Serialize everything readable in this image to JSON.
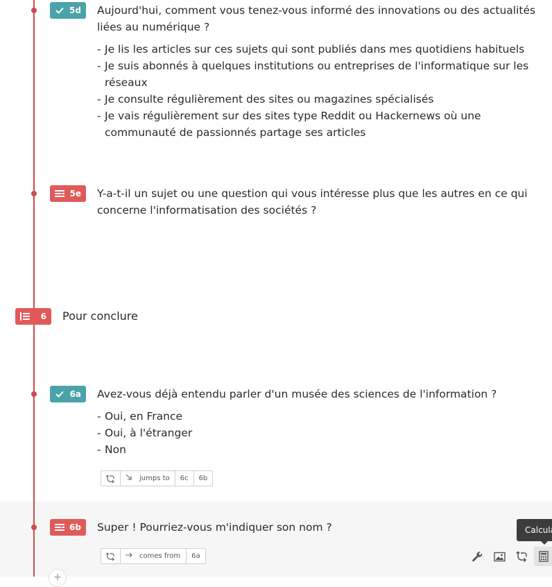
{
  "questions": {
    "q5d": {
      "number": "5d",
      "type": "multiple-choice",
      "text": "Aujourd'hui, comment vous tenez-vous informé des innovations ou des actualités liées au numérique ?",
      "answers": [
        "Je lis les articles sur ces sujets qui sont publiés dans mes quotidiens habituels",
        "Je suis abonnés à quelques institutions ou entreprises de l'informatique sur les réseaux",
        "Je consulte régulièrement des sites ou magazines spécialisés",
        "Je vais régulièrement sur des sites type Reddit ou Hackernews où une communauté de passionnés partage ses articles"
      ]
    },
    "q5e": {
      "number": "5e",
      "type": "free-text",
      "text": "Y-a-t-il un sujet ou une question qui vous intéresse plus que les autres en ce qui concerne l'informatisation des sociétés ?"
    },
    "section6": {
      "number": "6",
      "title": "Pour conclure"
    },
    "q6a": {
      "number": "6a",
      "type": "multiple-choice",
      "text": "Avez-vous déjà entendu parler d'un musée des sciences de l'information ?",
      "answers": [
        "Oui, en France",
        "Oui, à l'étranger",
        "Non"
      ],
      "logic": {
        "label": "jumps to",
        "targets": [
          "6c",
          "6b"
        ]
      }
    },
    "q6b": {
      "number": "6b",
      "type": "free-text",
      "text": "Super ! Pourriez-vous m'indiquer son nom ?",
      "logic": {
        "label": "comes from",
        "targets": [
          "6a"
        ]
      }
    }
  },
  "toolbar": {
    "tooltip": "Calcula",
    "icons": [
      "wrench-icon",
      "image-icon",
      "logic-icon",
      "calculator-icon"
    ]
  },
  "colors": {
    "accent_red": "#e05a5a",
    "accent_teal": "#4aa3a8",
    "timeline": "#d24a4a"
  }
}
